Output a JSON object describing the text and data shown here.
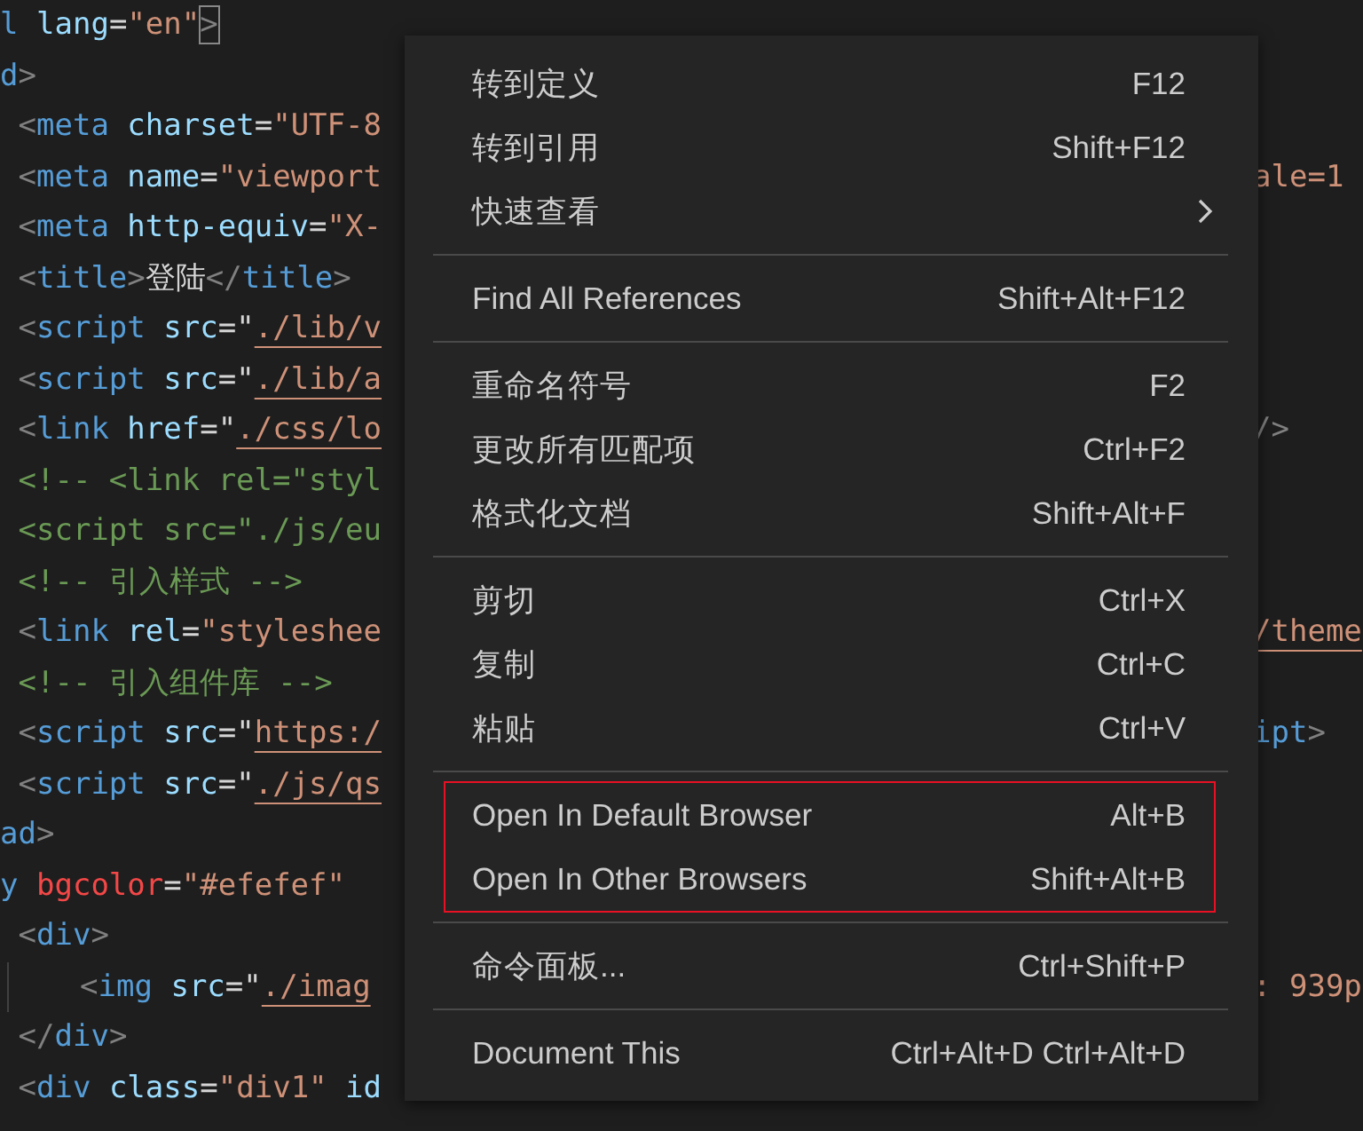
{
  "editor": {
    "lines": [
      {
        "guide": false,
        "tokens": [
          {
            "kind": "tag",
            "text": "l"
          },
          {
            "kind": "attr",
            "text": " lang"
          },
          {
            "kind": "plain",
            "text": "="
          },
          {
            "kind": "str",
            "text": "\"en\""
          },
          {
            "kind": "punct",
            "text": ">",
            "matched": true
          }
        ]
      },
      {
        "guide": false,
        "tokens": [
          {
            "kind": "tag",
            "text": "d"
          },
          {
            "kind": "punct",
            "text": ">"
          }
        ]
      },
      {
        "guide": false,
        "tokens": [
          {
            "kind": "punct",
            "text": " <"
          },
          {
            "kind": "tag",
            "text": "meta"
          },
          {
            "kind": "attr",
            "text": " charset"
          },
          {
            "kind": "plain",
            "text": "="
          },
          {
            "kind": "str",
            "text": "\"UTF-8"
          }
        ]
      },
      {
        "guide": false,
        "tokens": [
          {
            "kind": "punct",
            "text": " <"
          },
          {
            "kind": "tag",
            "text": "meta"
          },
          {
            "kind": "attr",
            "text": " name"
          },
          {
            "kind": "plain",
            "text": "="
          },
          {
            "kind": "str",
            "text": "\"viewport"
          }
        ],
        "end": [
          {
            "kind": "str",
            "text": "ale=1"
          }
        ]
      },
      {
        "guide": false,
        "tokens": [
          {
            "kind": "punct",
            "text": " <"
          },
          {
            "kind": "tag",
            "text": "meta"
          },
          {
            "kind": "attr",
            "text": " http-equiv"
          },
          {
            "kind": "plain",
            "text": "="
          },
          {
            "kind": "str",
            "text": "\"X-"
          }
        ]
      },
      {
        "guide": false,
        "tokens": [
          {
            "kind": "punct",
            "text": " <"
          },
          {
            "kind": "tag",
            "text": "title"
          },
          {
            "kind": "punct",
            "text": ">"
          },
          {
            "kind": "plain",
            "text": "登陆"
          },
          {
            "kind": "punct",
            "text": "</"
          },
          {
            "kind": "tag",
            "text": "title"
          },
          {
            "kind": "punct",
            "text": ">"
          }
        ]
      },
      {
        "guide": false,
        "tokens": [
          {
            "kind": "punct",
            "text": " <"
          },
          {
            "kind": "tag",
            "text": "script"
          },
          {
            "kind": "attr",
            "text": " src"
          },
          {
            "kind": "plain",
            "text": "=\""
          },
          {
            "kind": "link",
            "text": "./lib/v"
          }
        ]
      },
      {
        "guide": false,
        "tokens": [
          {
            "kind": "punct",
            "text": " <"
          },
          {
            "kind": "tag",
            "text": "script"
          },
          {
            "kind": "attr",
            "text": " src"
          },
          {
            "kind": "plain",
            "text": "=\""
          },
          {
            "kind": "link",
            "text": "./lib/a"
          }
        ]
      },
      {
        "guide": false,
        "tokens": [
          {
            "kind": "punct",
            "text": " <"
          },
          {
            "kind": "tag",
            "text": "link"
          },
          {
            "kind": "attr",
            "text": " href"
          },
          {
            "kind": "plain",
            "text": "=\""
          },
          {
            "kind": "link",
            "text": "./css/lo"
          }
        ],
        "end": [
          {
            "kind": "punct",
            "text": "/>"
          }
        ]
      },
      {
        "guide": false,
        "tokens": [
          {
            "kind": "comment",
            "text": " <!-- <link rel=\"styl"
          }
        ]
      },
      {
        "guide": false,
        "tokens": [
          {
            "kind": "comment",
            "text": " <script src=\"./js/eu"
          }
        ]
      },
      {
        "guide": false,
        "tokens": [
          {
            "kind": "comment",
            "text": " <!-- 引入样式 -->"
          }
        ]
      },
      {
        "guide": false,
        "tokens": [
          {
            "kind": "punct",
            "text": " <"
          },
          {
            "kind": "tag",
            "text": "link"
          },
          {
            "kind": "attr",
            "text": " rel"
          },
          {
            "kind": "plain",
            "text": "="
          },
          {
            "kind": "str",
            "text": "\"styleshee"
          }
        ],
        "end": [
          {
            "kind": "link",
            "text": "/theme"
          }
        ]
      },
      {
        "guide": false,
        "tokens": [
          {
            "kind": "comment",
            "text": " <!-- 引入组件库 -->"
          }
        ]
      },
      {
        "guide": false,
        "tokens": [
          {
            "kind": "punct",
            "text": " <"
          },
          {
            "kind": "tag",
            "text": "script"
          },
          {
            "kind": "attr",
            "text": " src"
          },
          {
            "kind": "plain",
            "text": "=\""
          },
          {
            "kind": "link",
            "text": "https:/"
          }
        ],
        "end": [
          {
            "kind": "tag",
            "text": "ipt"
          },
          {
            "kind": "punct",
            "text": ">"
          }
        ]
      },
      {
        "guide": false,
        "tokens": [
          {
            "kind": "punct",
            "text": " <"
          },
          {
            "kind": "tag",
            "text": "script"
          },
          {
            "kind": "attr",
            "text": " src"
          },
          {
            "kind": "plain",
            "text": "=\""
          },
          {
            "kind": "link",
            "text": "./js/qs"
          }
        ]
      },
      {
        "guide": false,
        "tokens": [
          {
            "kind": "tag",
            "text": "ad"
          },
          {
            "kind": "punct",
            "text": ">"
          }
        ]
      },
      {
        "guide": false,
        "tokens": [
          {
            "kind": "tag",
            "text": "y"
          },
          {
            "kind": "error",
            "text": " bgcolor"
          },
          {
            "kind": "plain",
            "text": "="
          },
          {
            "kind": "str",
            "text": "\"#efefef\""
          }
        ]
      },
      {
        "guide": false,
        "tokens": [
          {
            "kind": "punct",
            "text": " <"
          },
          {
            "kind": "tag",
            "text": "div"
          },
          {
            "kind": "punct",
            "text": ">"
          }
        ]
      },
      {
        "guide": true,
        "tokens": [
          {
            "kind": "punct",
            "text": "<"
          },
          {
            "kind": "tag",
            "text": "img"
          },
          {
            "kind": "attr",
            "text": " src"
          },
          {
            "kind": "plain",
            "text": "=\""
          },
          {
            "kind": "link",
            "text": "./imag"
          }
        ],
        "end": [
          {
            "kind": "str",
            "text": ": 939p"
          }
        ]
      },
      {
        "guide": false,
        "tokens": [
          {
            "kind": "punct",
            "text": " </"
          },
          {
            "kind": "tag",
            "text": "div"
          },
          {
            "kind": "punct",
            "text": ">"
          }
        ]
      },
      {
        "guide": false,
        "tokens": [
          {
            "kind": "punct",
            "text": " <"
          },
          {
            "kind": "tag",
            "text": "div"
          },
          {
            "kind": "attr",
            "text": " class"
          },
          {
            "kind": "plain",
            "text": "="
          },
          {
            "kind": "str",
            "text": "\"div1\""
          },
          {
            "kind": "attr",
            "text": " id"
          }
        ]
      }
    ]
  },
  "context_menu": {
    "groups": [
      {
        "highlighted": false,
        "items": [
          {
            "label": "转到定义",
            "shortcut": "F12",
            "submenu": false
          },
          {
            "label": "转到引用",
            "shortcut": "Shift+F12",
            "submenu": false
          },
          {
            "label": "快速查看",
            "submenu": true
          }
        ]
      },
      {
        "highlighted": false,
        "items": [
          {
            "label": "Find All References",
            "shortcut": "Shift+Alt+F12",
            "submenu": false
          }
        ]
      },
      {
        "highlighted": false,
        "items": [
          {
            "label": "重命名符号",
            "shortcut": "F2",
            "submenu": false
          },
          {
            "label": "更改所有匹配项",
            "shortcut": "Ctrl+F2",
            "submenu": false
          },
          {
            "label": "格式化文档",
            "shortcut": "Shift+Alt+F",
            "submenu": false
          }
        ]
      },
      {
        "highlighted": false,
        "items": [
          {
            "label": "剪切",
            "shortcut": "Ctrl+X",
            "submenu": false
          },
          {
            "label": "复制",
            "shortcut": "Ctrl+C",
            "submenu": false
          },
          {
            "label": "粘贴",
            "shortcut": "Ctrl+V",
            "submenu": false
          }
        ]
      },
      {
        "highlighted": true,
        "items": [
          {
            "label": "Open In Default Browser",
            "shortcut": "Alt+B",
            "submenu": false
          },
          {
            "label": "Open In Other Browsers",
            "shortcut": "Shift+Alt+B",
            "submenu": false
          }
        ]
      },
      {
        "highlighted": false,
        "items": [
          {
            "label": "命令面板...",
            "shortcut": "Ctrl+Shift+P",
            "submenu": false
          }
        ]
      },
      {
        "highlighted": false,
        "items": [
          {
            "label": "Document This",
            "shortcut": "Ctrl+Alt+D Ctrl+Alt+D",
            "submenu": false
          }
        ]
      }
    ]
  }
}
